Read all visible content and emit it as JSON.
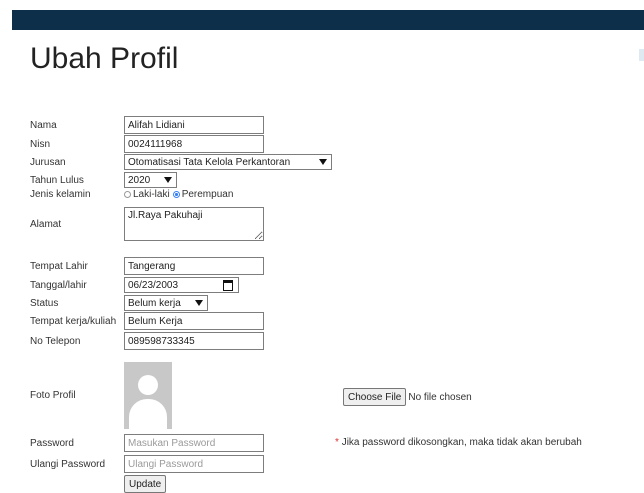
{
  "header": {
    "title": "Ubah Profil"
  },
  "form": {
    "nama": {
      "label": "Nama",
      "value": "Alifah Lidiani"
    },
    "nisn": {
      "label": "Nisn",
      "value": "0024111968"
    },
    "jurusan": {
      "label": "Jurusan",
      "value": "Otomatisasi Tata Kelola Perkantoran"
    },
    "tahun_lulus": {
      "label": "Tahun Lulus",
      "value": "2020"
    },
    "jenis_kelamin": {
      "label": "Jenis kelamin",
      "options": [
        {
          "label": "Laki-laki",
          "checked": false
        },
        {
          "label": "Perempuan",
          "checked": true
        }
      ]
    },
    "alamat": {
      "label": "Alamat",
      "value": "Jl.Raya Pakuhaji"
    },
    "tempat_lahir": {
      "label": "Tempat Lahir",
      "value": "Tangerang"
    },
    "tanggal_lahir": {
      "label": "Tanggal/lahir",
      "value": "06/23/2003"
    },
    "status": {
      "label": "Status",
      "value": "Belum kerja"
    },
    "tempat_kerja": {
      "label": "Tempat kerja/kuliah",
      "value": "Belum Kerja"
    },
    "no_telepon": {
      "label": "No Telepon",
      "value": "089598733345"
    },
    "foto_profil": {
      "label": "Foto Profil",
      "button": "Choose File",
      "status": "No file chosen"
    },
    "password": {
      "label": "Password",
      "placeholder": "Masukan Password",
      "note_marker": "*",
      "note": "Jika password dikosongkan, maka tidak akan berubah"
    },
    "ulangi_password": {
      "label": "Ulangi Password",
      "placeholder": "Ulangi Password"
    },
    "update_button": "Update"
  },
  "colors": {
    "topbar": "#0d2f4a",
    "radio_selected": "#3b82f6"
  }
}
